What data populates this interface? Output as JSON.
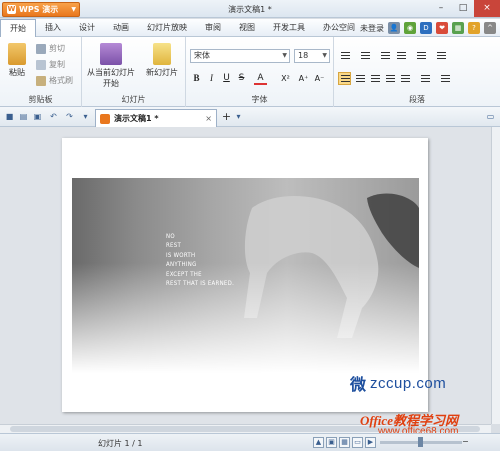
{
  "app": {
    "name": "WPS 演示",
    "logo_letter": "W",
    "doc_title": "演示文稿1 *"
  },
  "menu": {
    "tabs": [
      "开始",
      "插入",
      "设计",
      "动画",
      "幻灯片放映",
      "审阅",
      "视图",
      "开发工具",
      "办公空间"
    ],
    "active": "开始",
    "login": "未登录"
  },
  "ribbon": {
    "clipboard": {
      "paste": "粘贴",
      "cut": "剪切",
      "copy": "复制",
      "format_painter": "格式刷",
      "label": "剪贴板"
    },
    "slides": {
      "from_current": "从当前幻灯片",
      "from_current2": "开始",
      "new_slide": "新幻灯片",
      "label": "幻灯片"
    },
    "font": {
      "family": "宋体",
      "size": "18",
      "bold": "B",
      "italic": "I",
      "underline": "U",
      "strike": "S",
      "color": "A",
      "superscript": "X²",
      "subscript": "X₂",
      "grow": "A⁺",
      "shrink": "A⁻",
      "label": "字体"
    },
    "paragraph": {
      "label": "段落"
    }
  },
  "tabbar": {
    "doc_tab": "演示文稿1 *",
    "close": "×",
    "new_tab": "+"
  },
  "slide": {
    "quote_lines": [
      "NO",
      "REST",
      "IS WORTH",
      "ANYTHING",
      "EXCEPT THE",
      "REST THAT IS EARNED."
    ],
    "brand_text": "zccup.com",
    "brand_glyph": "微"
  },
  "watermark": {
    "line1": "Office教程学习网",
    "line2": "www.office68.com"
  },
  "status": {
    "slide_info": "幻灯片 1 / 1",
    "zoom": "−"
  },
  "colors": {
    "accent_orange": "#e9771d",
    "ribbon_blue": "#b9c7d6",
    "brand_blue": "#1e4f9e",
    "watermark_red": "#e04010"
  }
}
